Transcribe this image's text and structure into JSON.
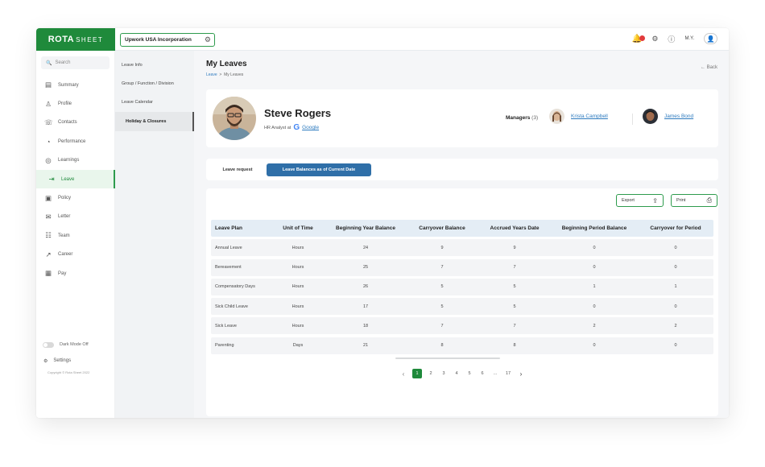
{
  "brand": {
    "name": "ROTA",
    "name_suffix": "SHEET",
    "accent": "#1f8a3b",
    "link_color": "#2e7bbf",
    "tab_active_color": "#2f6fa8"
  },
  "topbar": {
    "company": "Upwork USA Incorporation",
    "user_initials": "M.Y.",
    "icons": [
      "bell-icon",
      "gear-icon",
      "help-icon",
      "user-icon"
    ]
  },
  "sidebar": {
    "search_placeholder": "Search",
    "items": [
      {
        "label": "Summary",
        "icon": "summary-icon"
      },
      {
        "label": "Profile",
        "icon": "profile-icon"
      },
      {
        "label": "Contacts",
        "icon": "contacts-icon"
      },
      {
        "label": "Performance",
        "icon": "performance-icon"
      },
      {
        "label": "Learnings",
        "icon": "learnings-icon"
      },
      {
        "label": "Leave",
        "icon": "leave-icon",
        "active": true
      },
      {
        "label": "Policy",
        "icon": "policy-icon"
      },
      {
        "label": "Letter",
        "icon": "letter-icon"
      },
      {
        "label": "Team",
        "icon": "team-icon"
      },
      {
        "label": "Career",
        "icon": "career-icon"
      },
      {
        "label": "Pay",
        "icon": "pay-icon"
      }
    ],
    "dark_mode_label": "Dark Mode Off",
    "settings_label": "Settings",
    "copyright": "Copyright © Rota Sheet 2022"
  },
  "submenu": {
    "items": [
      "Leave Info",
      "Group / Function / Division",
      "Leave Calendar",
      "Holiday & Closures"
    ],
    "active_index": 3
  },
  "page": {
    "title": "My Leaves",
    "breadcrumb": {
      "root": "Leave",
      "separator": ">",
      "current": "My Leaves"
    },
    "back_label": "← Back"
  },
  "profile": {
    "name": "Steve Rogers",
    "role_prefix": "HR Analyst at",
    "company": "Google",
    "managers_label": "Managers",
    "managers_count": "(3)",
    "managers": [
      "Krista Campbell",
      "James Bond"
    ]
  },
  "tabs": [
    "Leave request",
    "Leave Balances as of Current Date"
  ],
  "actions": {
    "export_label": "Export",
    "print_label": "Print"
  },
  "table": {
    "columns": [
      "Leave Plan",
      "Unit of Time",
      "Beginning Year Balance",
      "Carryover Balance",
      "Accrued Years Date",
      "Beginning Period Balance",
      "Carryover for Period"
    ],
    "rows": [
      [
        "Annual Leave",
        "Hours",
        "24",
        "9",
        "9",
        "0",
        "0"
      ],
      [
        "Bereavement",
        "Hours",
        "25",
        "7",
        "7",
        "0",
        "0"
      ],
      [
        "Compensatory Days",
        "Hours",
        "26",
        "5",
        "5",
        "1",
        "1"
      ],
      [
        "Sick Child Leave",
        "Hours",
        "17",
        "5",
        "5",
        "0",
        "0"
      ],
      [
        "Sick Leave",
        "Hours",
        "18",
        "7",
        "7",
        "2",
        "2"
      ],
      [
        "Parenting",
        "Days",
        "21",
        "8",
        "8",
        "0",
        "0"
      ]
    ]
  },
  "pagination": {
    "pages": [
      "1",
      "2",
      "3",
      "4",
      "5",
      "6",
      "...",
      "17"
    ],
    "current": "1"
  }
}
